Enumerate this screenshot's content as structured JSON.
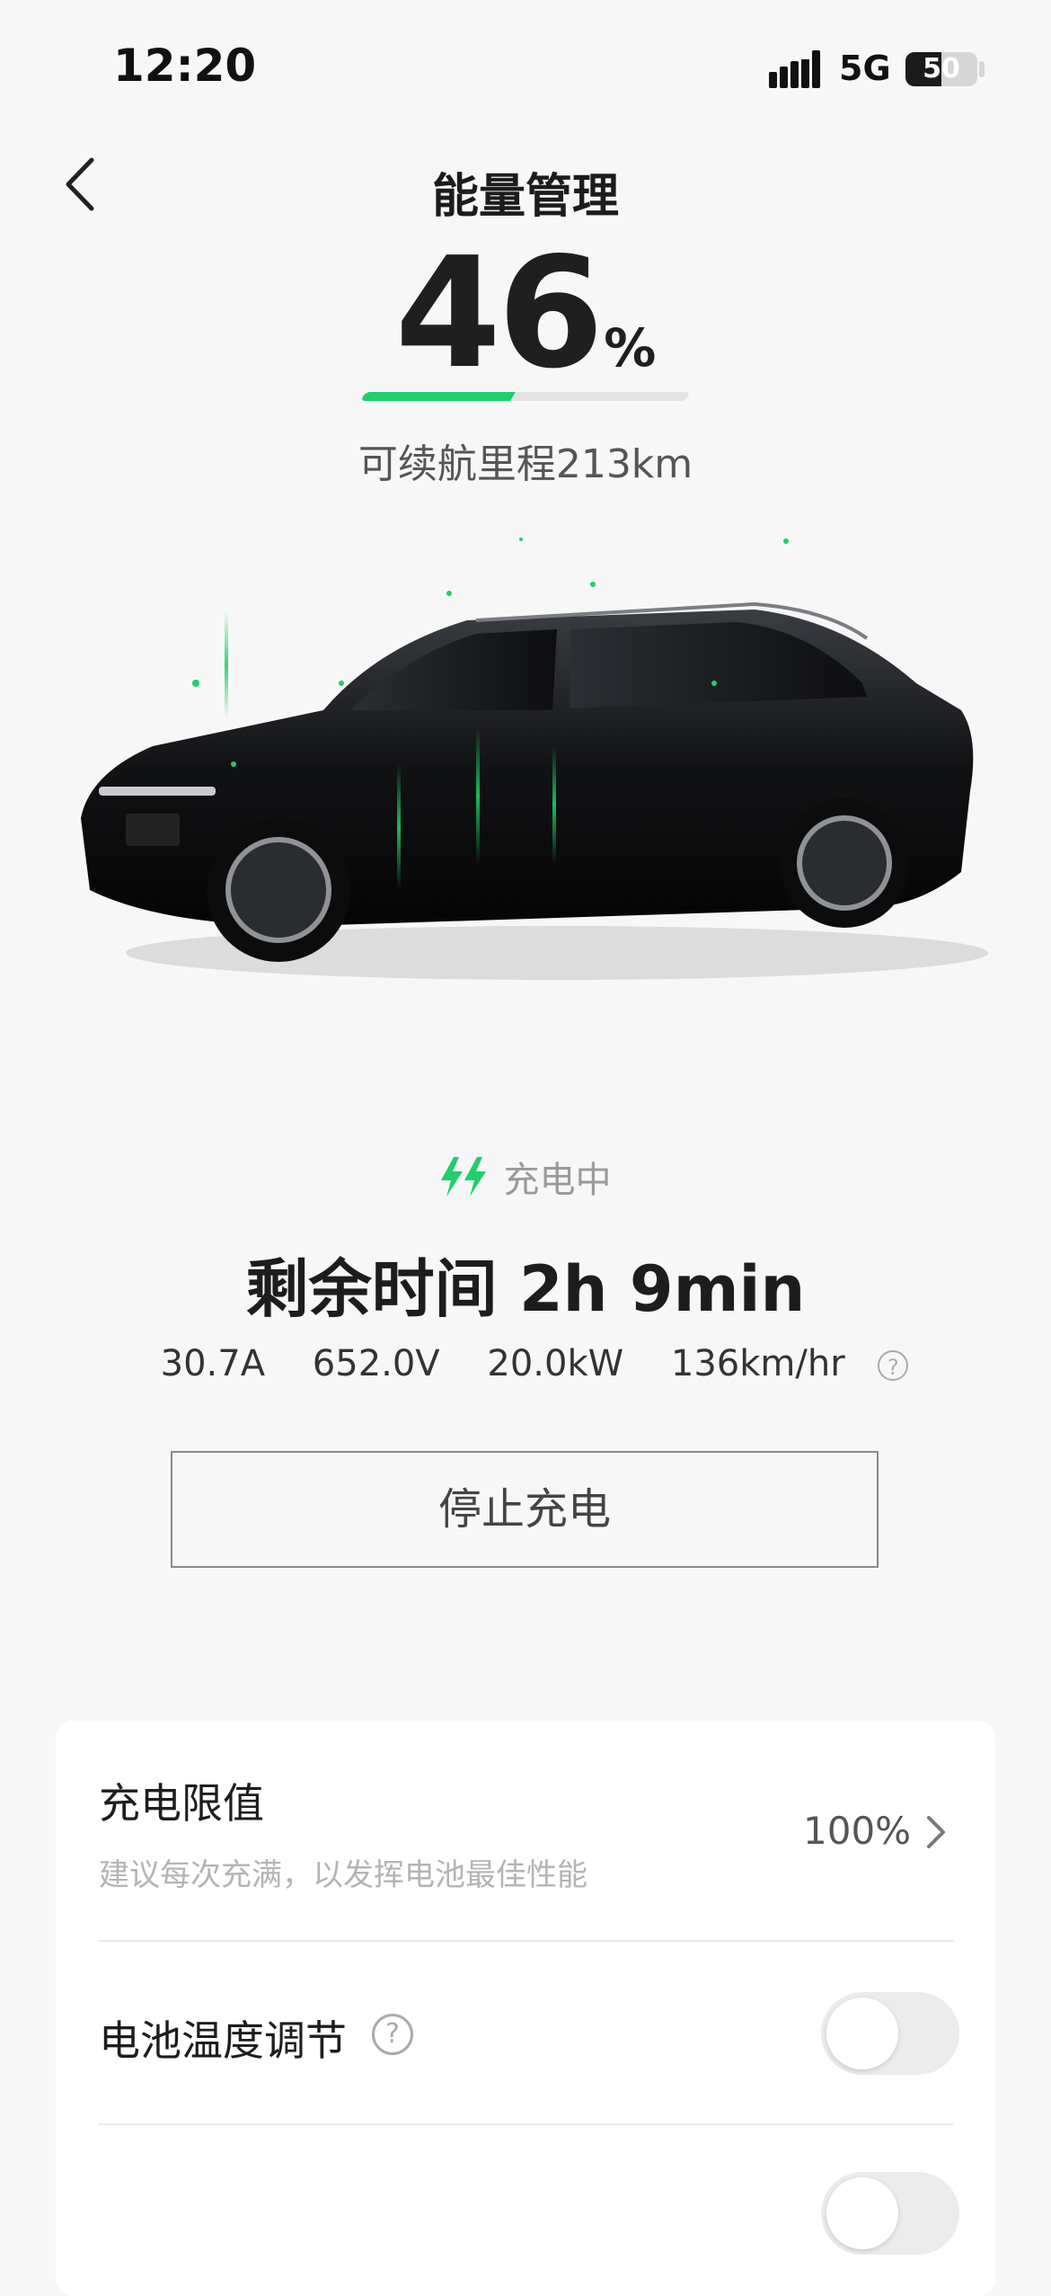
{
  "status_bar": {
    "time": "12:20",
    "network": "5G",
    "battery": "50"
  },
  "header": {
    "title": "能量管理"
  },
  "soc": {
    "value": "46",
    "unit": "%",
    "level_percent": 46,
    "range_text": "可续航里程213km"
  },
  "charging": {
    "status": "充电中",
    "remaining": "剩余时间 2h 9min",
    "metrics": [
      "30.7A",
      "652.0V",
      "20.0kW",
      "136km/hr"
    ],
    "stop_button": "停止充电"
  },
  "settings": {
    "limit": {
      "title": "充电限值",
      "subtitle": "建议每次充满，以发挥电池最佳性能",
      "value": "100%"
    },
    "battery_temp": {
      "title": "电池温度调节",
      "enabled": false
    }
  },
  "colors": {
    "accent": "#1fcf6a",
    "background": "#f7f7f7"
  },
  "icons": {
    "back": "chevron-left-icon",
    "charging": "double-bolt-icon",
    "help": "question-circle-icon",
    "limit_arrow": "chevron-right-icon"
  }
}
